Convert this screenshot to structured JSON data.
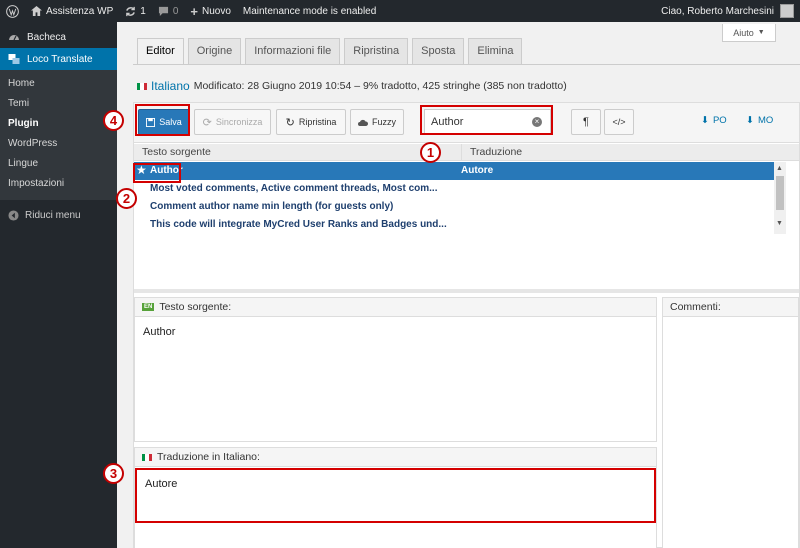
{
  "admin_bar": {
    "site_name": "Assistenza WP",
    "updates_count": "1",
    "comments_count": "0",
    "new_label": "Nuovo",
    "maintenance_label": "Maintenance mode is enabled",
    "greeting": "Ciao, Roberto Marchesini"
  },
  "sidebar": {
    "dashboard_label": "Bacheca",
    "loco_label": "Loco Translate",
    "submenu": [
      "Home",
      "Temi",
      "Plugin",
      "WordPress",
      "Lingue",
      "Impostazioni"
    ],
    "active_submenu": "Plugin",
    "collapse_label": "Riduci menu"
  },
  "help_label": "Aiuto",
  "tabs": [
    "Editor",
    "Origine",
    "Informazioni file",
    "Ripristina",
    "Sposta",
    "Elimina"
  ],
  "active_tab": "Editor",
  "status": {
    "language": "Italiano",
    "details": "Modificato: 28 Giugno 2019 10:54 – 9% tradotto, 425 stringhe (385 non tradotto)"
  },
  "toolbar": {
    "save_label": "Salva",
    "sync_label": "Sincronizza",
    "revert_label": "Ripristina",
    "fuzzy_label": "Fuzzy",
    "search_value": "Author",
    "po_label": "PO",
    "mo_label": "MO",
    "pilcrow": "¶",
    "code": "</>"
  },
  "grid": {
    "col_source": "Testo sorgente",
    "col_translation": "Traduzione",
    "rows": [
      {
        "source": "Author",
        "translation": "Autore",
        "selected": true
      },
      {
        "source": "Most voted comments, Active comment threads, Most com...",
        "translation": ""
      },
      {
        "source": "Comment author name min length (for guests only)",
        "translation": ""
      },
      {
        "source": "This code will integrate MyCred User Ranks and Badges und...",
        "translation": ""
      }
    ]
  },
  "source_pane": {
    "lang_code": "EN",
    "title": "Testo sorgente:",
    "text": "Author"
  },
  "comments_pane": {
    "title": "Commenti:"
  },
  "translation_pane": {
    "title": "Traduzione in Italiano:",
    "text": "Autore"
  },
  "callouts": [
    "1",
    "2",
    "3",
    "4"
  ],
  "colors": {
    "accent": "#0073aa",
    "admin_dark": "#23282d",
    "annotation_red": "#d40000"
  }
}
